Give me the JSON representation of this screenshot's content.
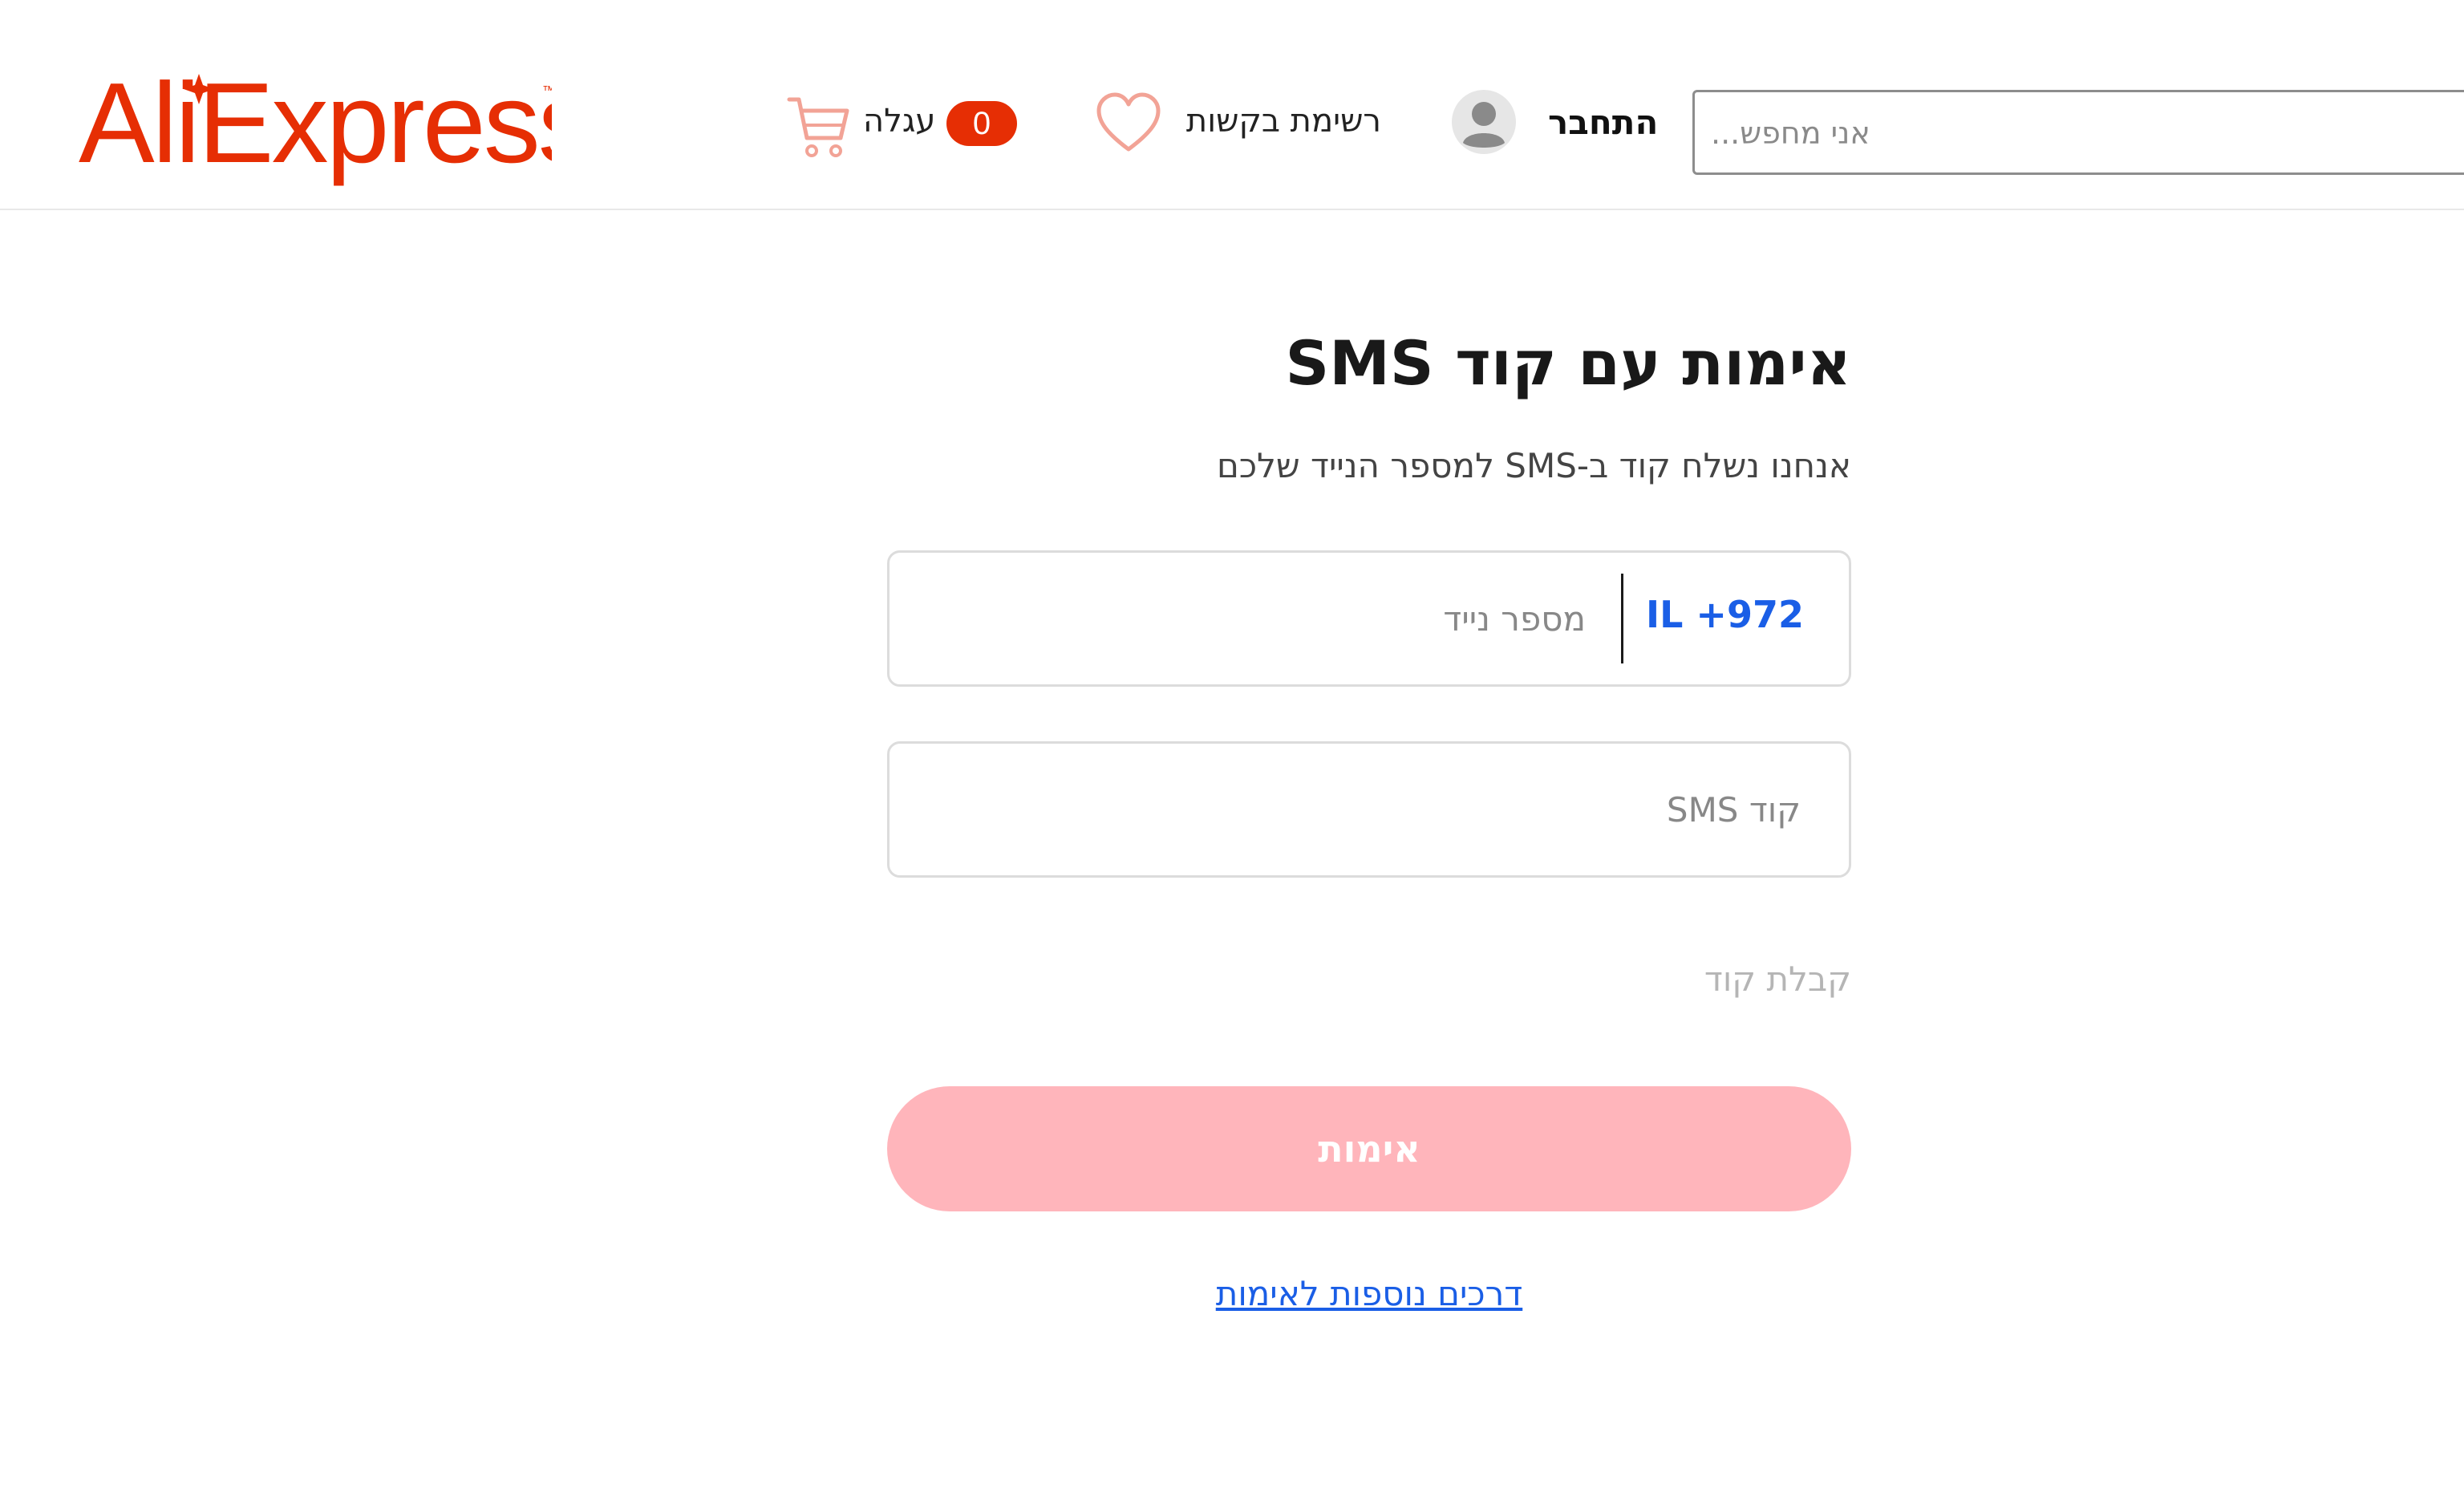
{
  "header": {
    "logo_text": "AliExpress",
    "cart": {
      "label": "עגלה",
      "count": "0"
    },
    "wishlist": {
      "label": "רשימת בקשות"
    },
    "login": {
      "label": "התחבר"
    },
    "search": {
      "placeholder": "...אני מחפש"
    }
  },
  "main": {
    "title": "אימות עם קוד SMS",
    "subtitle": "אנחנו נשלח קוד ב-SMS למספר הנייד שלכם",
    "phone": {
      "country_code": "IL +972",
      "placeholder": "מספר נייד"
    },
    "sms_code": {
      "placeholder": "קוד SMS"
    },
    "get_code_label": "קבלת קוד",
    "verify_button_label": "אימות",
    "more_methods_link": "דרכים נוספות לאימות"
  },
  "colors": {
    "brand": "#e62e04",
    "link": "#1a5ee6",
    "verify_button_disabled": "#ffb5bb"
  },
  "icons": [
    "cart-icon",
    "heart-icon",
    "user-avatar-icon"
  ]
}
